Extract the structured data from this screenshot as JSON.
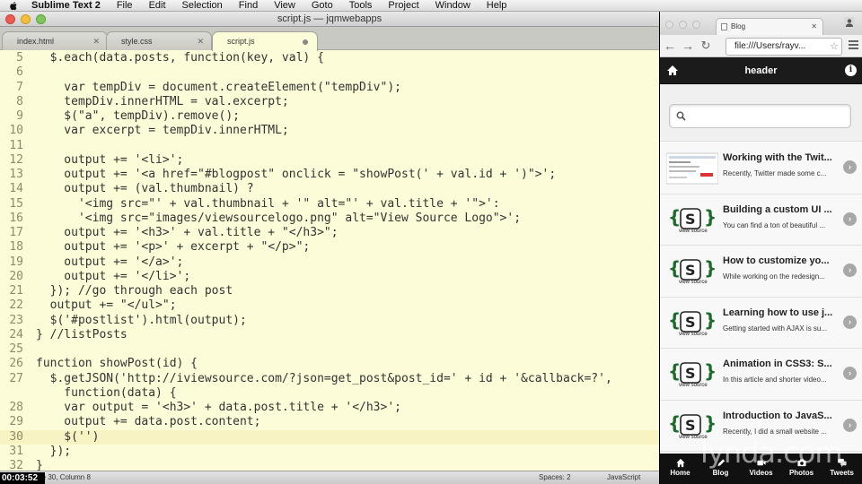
{
  "menubar": {
    "app_name": "Sublime Text 2",
    "items": [
      "File",
      "Edit",
      "Selection",
      "Find",
      "View",
      "Goto",
      "Tools",
      "Project",
      "Window",
      "Help"
    ]
  },
  "sublime": {
    "window_title": "script.js — jqmwebapps",
    "tabs": [
      {
        "label": "index.html",
        "state": "close"
      },
      {
        "label": "style.css",
        "state": "close"
      },
      {
        "label": "script.js",
        "state": "modified",
        "active": true
      }
    ],
    "lines": [
      {
        "num": "5",
        "text": "  $.each(data.posts, function(key, val) {"
      },
      {
        "num": "6",
        "text": ""
      },
      {
        "num": "7",
        "text": "    var tempDiv = document.createElement(\"tempDiv\");"
      },
      {
        "num": "8",
        "text": "    tempDiv.innerHTML = val.excerpt;"
      },
      {
        "num": "9",
        "text": "    $(\"a\", tempDiv).remove();"
      },
      {
        "num": "10",
        "text": "    var excerpt = tempDiv.innerHTML;"
      },
      {
        "num": "11",
        "text": ""
      },
      {
        "num": "12",
        "text": "    output += '<li>';"
      },
      {
        "num": "13",
        "text": "    output += '<a href=\"#blogpost\" onclick = \"showPost(' + val.id + ')\">';"
      },
      {
        "num": "14",
        "text": "    output += (val.thumbnail) ?"
      },
      {
        "num": "15",
        "text": "      '<img src=\"' + val.thumbnail + '\" alt=\"' + val.title + '\">':"
      },
      {
        "num": "16",
        "text": "      '<img src=\"images/viewsourcelogo.png\" alt=\"View Source Logo\">';"
      },
      {
        "num": "17",
        "text": "    output += '<h3>' + val.title + \"</h3>\";"
      },
      {
        "num": "18",
        "text": "    output += '<p>' + excerpt + \"</p>\";"
      },
      {
        "num": "19",
        "text": "    output += '</a>';"
      },
      {
        "num": "20",
        "text": "    output += '</li>';"
      },
      {
        "num": "21",
        "text": "  }); //go through each post"
      },
      {
        "num": "22",
        "text": "  output += \"</ul>\";"
      },
      {
        "num": "23",
        "text": "  $('#postlist').html(output);"
      },
      {
        "num": "24",
        "text": "} //listPosts"
      },
      {
        "num": "25",
        "text": ""
      },
      {
        "num": "26",
        "text": "function showPost(id) {"
      },
      {
        "num": "27",
        "text": "  $.getJSON('http://iviewsource.com/?json=get_post&post_id=' + id + '&callback=?',"
      },
      {
        "num": "",
        "text": "    function(data) {"
      },
      {
        "num": "28",
        "text": "    var output = '<h3>' + data.post.title + '</h3>';"
      },
      {
        "num": "29",
        "text": "    output += data.post.content;"
      },
      {
        "num": "30",
        "text": "    $('')"
      },
      {
        "num": "31",
        "text": "  });"
      },
      {
        "num": "32",
        "text": "}"
      }
    ],
    "current_line_index": 26,
    "status": {
      "left": "Line 30, Column 8",
      "spaces": "Spaces: 2",
      "syntax": "JavaScript"
    },
    "timestamp": "00:03:52"
  },
  "browser": {
    "tab_title": "Blog",
    "url": "file:///Users/rayv...",
    "header_title": "header",
    "search_placeholder": "",
    "posts": [
      {
        "title": "Working with the Twit...",
        "excerpt": "Recently, Twitter made some c...",
        "thumb": "screenshot"
      },
      {
        "title": "Building a custom UI ...",
        "excerpt": "You can find a ton of beautiful ...",
        "thumb": "viewsource"
      },
      {
        "title": "How to customize yo...",
        "excerpt": "While working on the redesign...",
        "thumb": "viewsource"
      },
      {
        "title": "Learning how to use j...",
        "excerpt": "Getting started with AJAX is su...",
        "thumb": "viewsource"
      },
      {
        "title": "Animation in CSS3: S...",
        "excerpt": "In this article and shorter video...",
        "thumb": "viewsource"
      },
      {
        "title": "Introduction to JavaS...",
        "excerpt": "Recently, I did a small website ...",
        "thumb": "viewsource"
      }
    ],
    "thumb_logo_text": "view source",
    "footer": [
      {
        "label": "Home",
        "icon": "home-icon"
      },
      {
        "label": "Blog",
        "icon": "pencil-icon"
      },
      {
        "label": "Videos",
        "icon": "video-icon"
      },
      {
        "label": "Photos",
        "icon": "camera-icon"
      },
      {
        "label": "Tweets",
        "icon": "chat-icon"
      }
    ],
    "watermark": "lynda.com"
  }
}
